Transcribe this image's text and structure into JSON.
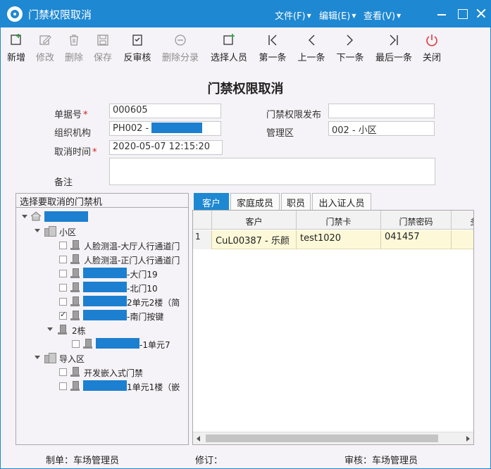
{
  "window": {
    "title": "门禁权限取消",
    "menus": [
      "文件(F)",
      "编辑(E)",
      "查看(V)"
    ]
  },
  "toolbar": {
    "items": [
      {
        "label": "新增",
        "icon": "add-icon",
        "enabled": true
      },
      {
        "label": "修改",
        "icon": "edit-icon",
        "enabled": false
      },
      {
        "label": "删除",
        "icon": "trash-icon",
        "enabled": false
      },
      {
        "label": "保存",
        "icon": "save-icon",
        "enabled": false
      },
      {
        "label": "反审核",
        "icon": "unapprove-icon",
        "enabled": true
      },
      {
        "label": "删除分录",
        "icon": "minus-circle-icon",
        "enabled": false
      },
      {
        "label": "选择人员",
        "icon": "select-person-icon",
        "enabled": true
      },
      {
        "label": "第一条",
        "icon": "first-record-icon",
        "enabled": true
      },
      {
        "label": "上一条",
        "icon": "prev-record-icon",
        "enabled": true
      },
      {
        "label": "下一条",
        "icon": "next-record-icon",
        "enabled": true
      },
      {
        "label": "最后一条",
        "icon": "last-record-icon",
        "enabled": true
      },
      {
        "label": "关闭",
        "icon": "power-icon",
        "enabled": true
      }
    ]
  },
  "form": {
    "heading": "门禁权限取消",
    "doc_no_label": "单据号",
    "doc_no_value": "000605",
    "org_label": "组织机构",
    "org_value": "PH002 -",
    "cancel_time_label": "取消时间",
    "cancel_time_value": "2020-05-07 12:15:20",
    "remark_label": "备注",
    "remark_value": "",
    "publish_label": "门禁权限发布",
    "publish_value": "",
    "area_label": "管理区",
    "area_value": "002 - 小区",
    "required_mark": "*"
  },
  "tree": {
    "header": "选择要取消的门禁机",
    "nodes": [
      {
        "text": "",
        "redacted_width": 62
      },
      {
        "text": "小区"
      },
      {
        "text": "人脸测温-大厅人行通道门",
        "checked": false
      },
      {
        "text": "人脸测温-正门人行通道门",
        "checked": false
      },
      {
        "text": "-大门19",
        "checked": false,
        "redacted_width": 62
      },
      {
        "text": "-北门10",
        "checked": false,
        "redacted_width": 62
      },
      {
        "text": "2单元2楼（简",
        "checked": false,
        "redacted_width": 62
      },
      {
        "text": "-南门按键",
        "checked": true,
        "redacted_width": 62
      },
      {
        "text": "2栋"
      },
      {
        "text": "-1单元7",
        "checked": false,
        "redacted_width": 62
      },
      {
        "text": "导入区"
      },
      {
        "text": "开发嵌入式门禁",
        "checked": false
      },
      {
        "text": "1单元1楼（嵌",
        "checked": false,
        "redacted_width": 62
      }
    ]
  },
  "tabs": [
    {
      "label": "客户",
      "active": true
    },
    {
      "label": "家庭成员",
      "active": false
    },
    {
      "label": "职员",
      "active": false
    },
    {
      "label": "出入证人员",
      "active": false
    }
  ],
  "grid": {
    "columns": [
      "客户",
      "门禁卡",
      "门禁密码",
      "多"
    ],
    "rows": [
      {
        "num": "1",
        "customer": "CuL00387 - 乐颜",
        "card": "test1020",
        "password": "041457"
      }
    ]
  },
  "footer": {
    "maker": "制单：车场管理员",
    "revise": "修订：",
    "auditor": "审核：车场管理员"
  },
  "colors": {
    "titlebar": "#1e88d2",
    "active_tab": "#1e88d2",
    "selected_row": "#fdf9d8",
    "redaction": "#1d7fd0"
  }
}
